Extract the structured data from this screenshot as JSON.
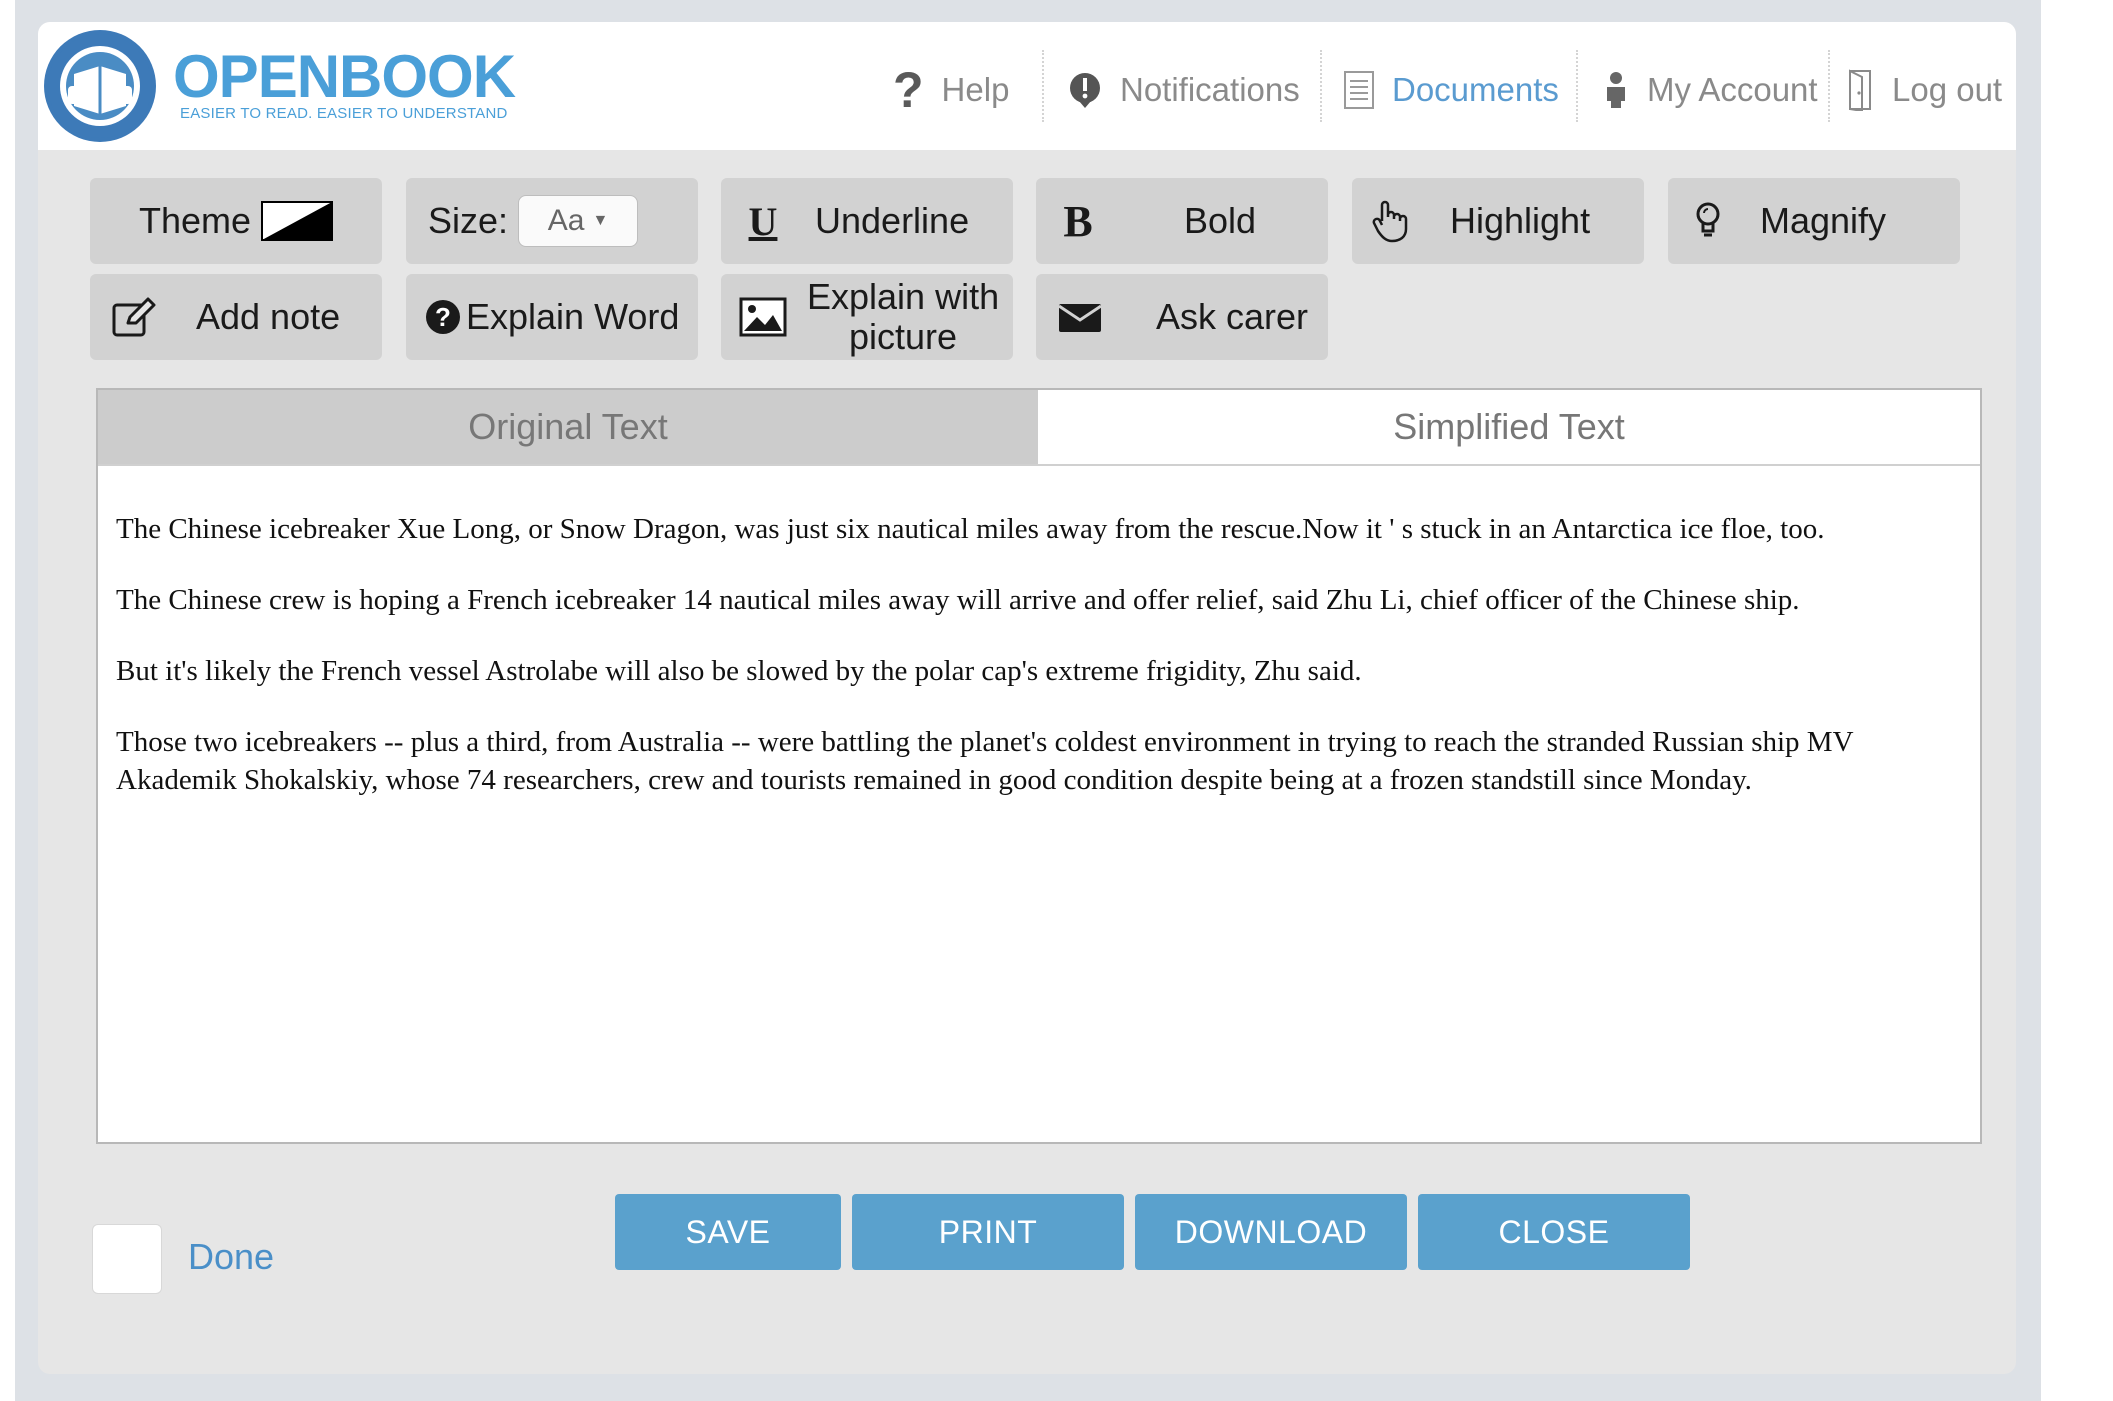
{
  "brand": {
    "name": "OPENBOOK",
    "tagline": "EASIER TO READ. EASIER TO UNDERSTAND",
    "color": "#4a9fd8"
  },
  "nav": {
    "help": "Help",
    "notifications": "Notifications",
    "documents": "Documents",
    "my_account": "My Account",
    "log_out": "Log out"
  },
  "toolbar": {
    "theme": "Theme",
    "size_label": "Size:",
    "size_value": "Aa",
    "underline": "Underline",
    "bold": "Bold",
    "highlight": "Highlight",
    "magnify": "Magnify",
    "add_note": "Add note",
    "explain_word": "Explain Word",
    "explain_picture_line1": "Explain with",
    "explain_picture_line2": "picture",
    "ask_carer": "Ask carer"
  },
  "tabs": {
    "original": "Original Text",
    "simplified": "Simplified Text",
    "active": "simplified"
  },
  "content": {
    "paragraphs": [
      "The Chinese icebreaker Xue Long, or Snow Dragon, was just six nautical miles away from the rescue.Now it ' s stuck in an Antarctica ice floe, too.",
      "The Chinese crew is hoping a French icebreaker 14 nautical miles away will arrive and offer relief, said Zhu Li, chief officer of the Chinese ship.",
      "But it's likely the French vessel Astrolabe will also be slowed by the polar cap's extreme frigidity, Zhu said.",
      "Those two icebreakers -- plus a third, from Australia -- were battling the planet's coldest environment in trying to reach the stranded Russian ship MV Akademik Shokalskiy, whose 74 researchers, crew and tourists remained in good condition despite being at a frozen standstill since Monday."
    ]
  },
  "bottom": {
    "done": "Done",
    "done_checked": false,
    "save": "SAVE",
    "print": "PRINT",
    "download": "DOWNLOAD",
    "close": "CLOSE"
  },
  "colors": {
    "accent_button": "#5aa1cd",
    "toolbar_button": "#d2d2d2",
    "active_nav": "#5a9bd0"
  },
  "icons": {
    "help": "question-mark-icon",
    "notifications": "alert-icon",
    "documents": "document-icon",
    "my_account": "person-icon",
    "log_out": "door-icon",
    "theme": "contrast-swatch-icon",
    "underline": "underline-icon",
    "bold": "bold-icon",
    "highlight": "pointing-hand-icon",
    "magnify": "lightbulb-icon",
    "add_note": "edit-note-icon",
    "explain_word": "question-circle-icon",
    "explain_picture": "picture-icon",
    "ask_carer": "envelope-icon"
  }
}
